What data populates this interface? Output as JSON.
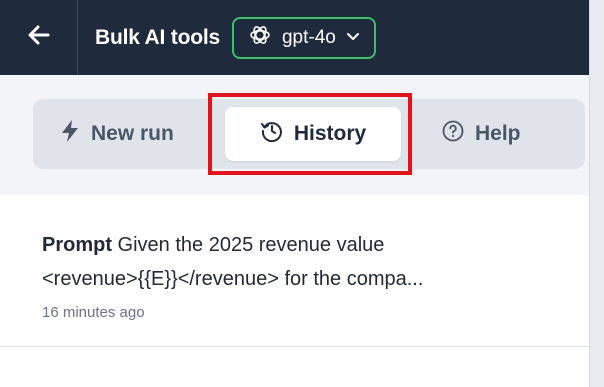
{
  "header": {
    "back_icon": "arrow-left-icon",
    "title": "Bulk AI tools",
    "model": {
      "icon": "openai-logo-icon",
      "label": "gpt-4o",
      "dropdown_icon": "chevron-down-icon"
    }
  },
  "tabs": [
    {
      "icon": "lightning-icon",
      "label": "New run"
    },
    {
      "icon": "history-clock-icon",
      "label": "History",
      "selected": true
    },
    {
      "icon": "question-circle-icon",
      "label": "Help"
    }
  ],
  "history": {
    "items": [
      {
        "prompt_label": "Prompt",
        "prompt_text_line1": " Given the 2025 revenue value",
        "prompt_text_line2": "<revenue>{{E}}</revenue> for the compa...",
        "time": "16 minutes ago"
      }
    ]
  },
  "colors": {
    "topbar": "#1f2a3c",
    "model_border": "#3fbf6a",
    "highlight": "#e0141d"
  }
}
